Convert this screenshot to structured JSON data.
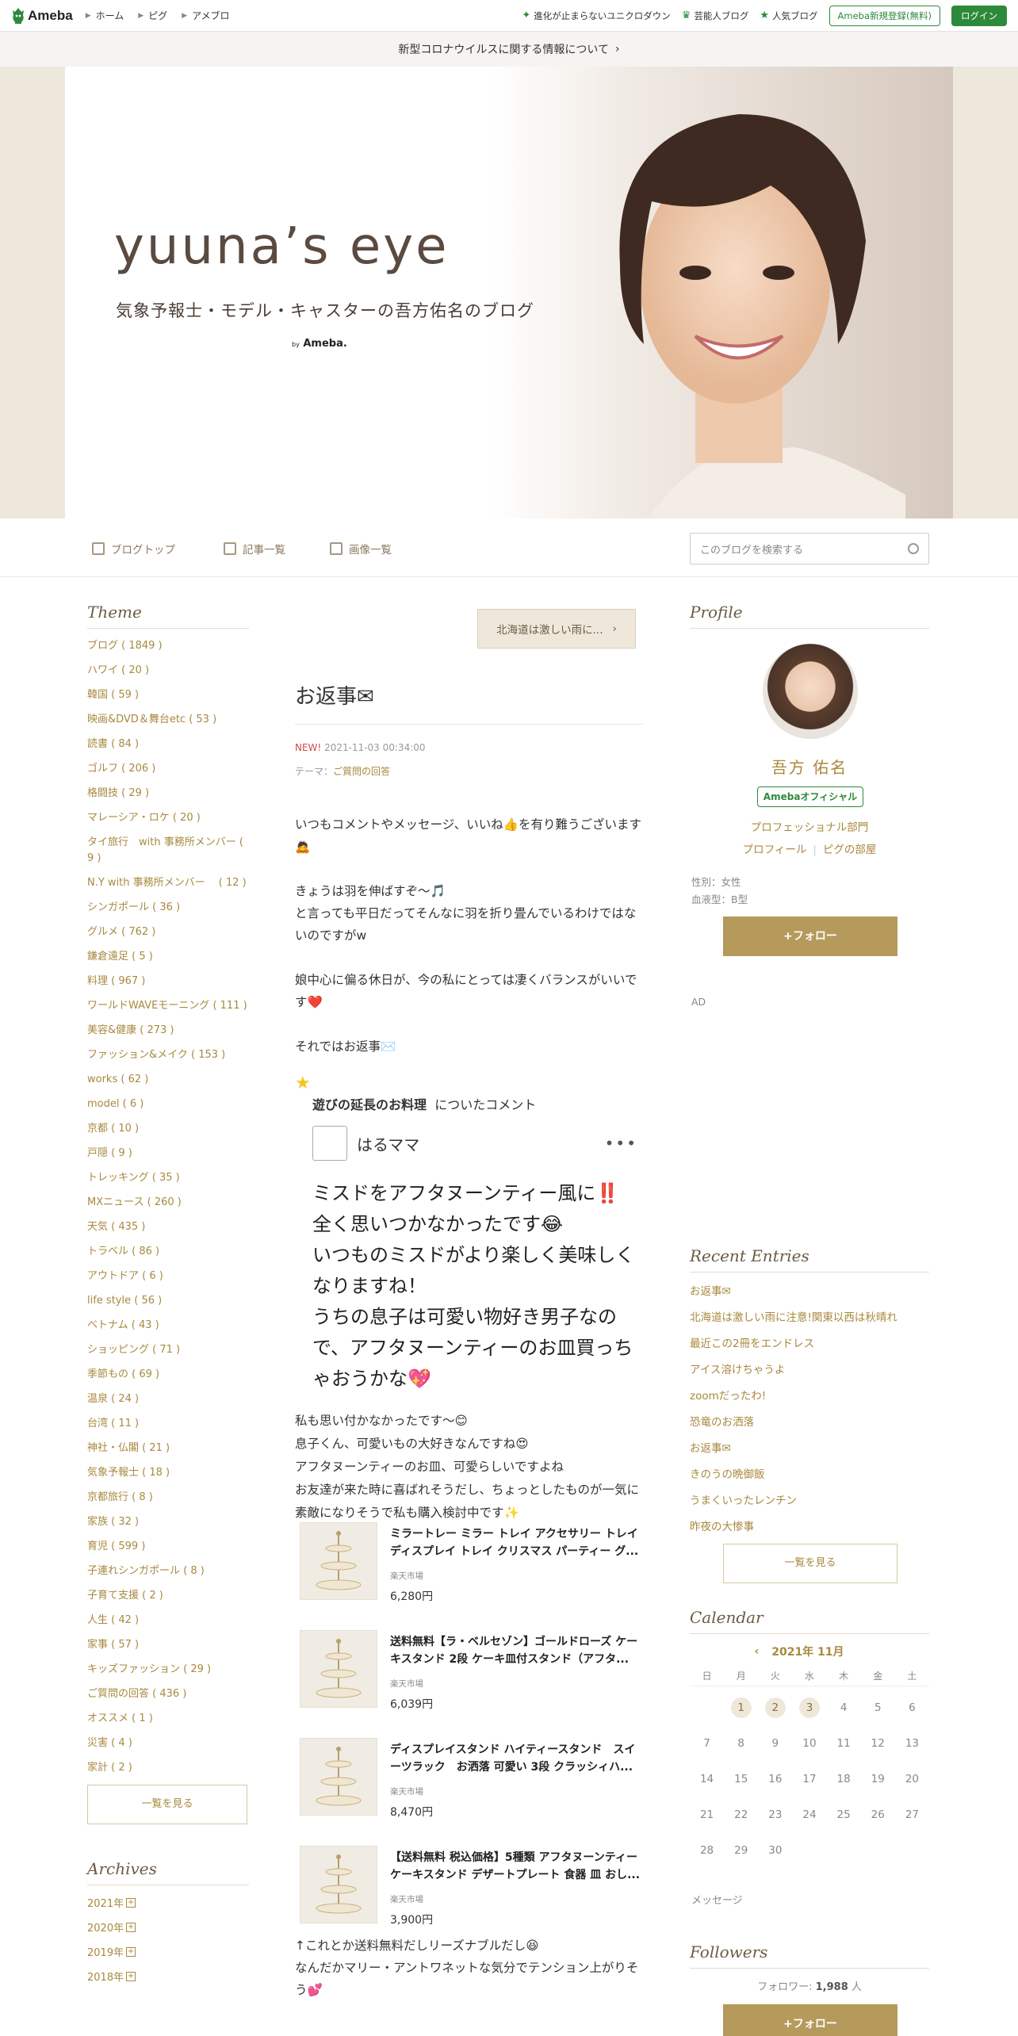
{
  "topbar": {
    "logo": "Ameba",
    "crumbs": [
      "ホーム",
      "ピグ",
      "アメブロ"
    ],
    "links": [
      {
        "label": "進化が止まらないユニクロダウン",
        "icon": "sparkle-icon"
      },
      {
        "label": "芸能人ブログ",
        "icon": "crown-icon"
      },
      {
        "label": "人気ブログ",
        "icon": "star-icon"
      }
    ],
    "register": "Ameba新規登録(無料)",
    "login": "ログイン",
    "accent": "#2d8a3a"
  },
  "notice": "新型コロナウイルスに関する情報について",
  "header": {
    "title": "yuuna’s eye",
    "subtitle": "気象予報士・モデル・キャスターの吾方佑名のブログ",
    "by": "by",
    "by_brand": "Ameba."
  },
  "nav": {
    "items": [
      "ブログトップ",
      "記事一覧",
      "画像一覧"
    ],
    "search_placeholder": "このブログを検索する"
  },
  "left": {
    "theme_title": "Theme",
    "themes": [
      "ブログ ( 1849 )",
      "ハワイ ( 20 )",
      "韓国 ( 59 )",
      "映画&DVD＆舞台etc ( 53 )",
      "読書 ( 84 )",
      "ゴルフ ( 206 )",
      "格闘技 ( 29 )",
      "マレーシア・ロケ ( 20 )",
      "タイ旅行　with 事務所メンバー ( 9 )",
      "N.Y with 事務所メンバー　 ( 12 )",
      "シンガポール ( 36 )",
      "グルメ ( 762 )",
      "鎌倉遠足 ( 5 )",
      "料理 ( 967 )",
      "ワールドWAVEモーニング ( 111 )",
      "美容&健康 ( 273 )",
      "ファッション&メイク ( 153 )",
      "works ( 62 )",
      "model ( 6 )",
      "京都 ( 10 )",
      "戸隠 ( 9 )",
      "トレッキング ( 35 )",
      "MXニュース ( 260 )",
      "天気 ( 435 )",
      "トラベル ( 86 )",
      "アウトドア ( 6 )",
      "life style ( 56 )",
      "ベトナム ( 43 )",
      "ショッピング ( 71 )",
      "季節もの ( 69 )",
      "温泉 ( 24 )",
      "台湾 ( 11 )",
      "神社・仏閣 ( 21 )",
      "気象予報士 ( 18 )",
      "京都旅行 ( 8 )",
      "家族 ( 32 )",
      "育児 ( 599 )",
      "子連れシンガポール ( 8 )",
      "子育て支援 ( 2 )",
      "人生 ( 42 )",
      "家事 ( 57 )",
      "キッズファッション ( 29 )",
      "ご質問の回答 ( 436 )",
      "オススメ ( 1 )",
      "災害 ( 4 )",
      "家計 ( 2 )"
    ],
    "more": "一覧を見る",
    "archive_title": "Archives",
    "archives": [
      "2021年",
      "2020年",
      "2019年",
      "2018年"
    ]
  },
  "post": {
    "prev_entry": "北海道は激しい雨に...",
    "title": "お返事✉",
    "new_label": "NEW!",
    "date": "2021-11-03 00:34:00",
    "theme_label": "テーマ：",
    "theme": "ご質問の回答",
    "paragraphs": [
      "いつもコメントやメッセージ、いいね👍を有り難うございます🙇",
      "きょうは羽を伸ばすぞ〜🎵\nと言っても平日だってそんなに羽を折り畳んでいるわけではないのですがw",
      "娘中心に偏る休日が、今の私にとっては凄くバランスがいいです❤️",
      "それではお返事✉️"
    ],
    "comment_source": "遊びの延長のお料理",
    "comment_source_suffix": "についたコメント",
    "commenter": "はるママ",
    "comment": "ミスドをアフタヌーンティー風に‼️\n全く思いつかなかったです😂\nいつものミスドがより楽しく美味しくなりますね！\nうちの息子は可愛い物好き男子なので、アフタヌーンティーのお皿買っちゃおうかな💖",
    "reply": "私も思い付かなかったです〜😊\n息子くん、可愛いもの大好きなんですね😍\nアフタヌーンティーのお皿、可愛らしいですよね\nお友達が来た時に喜ばれそうだし、ちょっとしたものが一気に素敵になりそうで私も購入検討中です✨",
    "products": [
      {
        "name": "ミラートレー ミラー トレイ アクセサリー トレイ ディスプレイ トレイ クリスマス パーティー グ...",
        "shop": "楽天市場",
        "price": "6,280円"
      },
      {
        "name": "送料無料【ラ・ベルセゾン】ゴールドローズ ケーキスタンド 2段 ケーキ皿付スタンド（アフタ...",
        "shop": "楽天市場",
        "price": "6,039円"
      },
      {
        "name": "ディスプレイスタンド ハイティースタンド　スイーツラック　お洒落 可愛い 3段 クラッシィハ...",
        "shop": "楽天市場",
        "price": "8,470円"
      },
      {
        "name": "【送料無料 税込価格】5種類 アフタヌーンティー ケーキスタンド デザートプレート 食器 皿 おし...",
        "shop": "楽天市場",
        "price": "3,900円"
      }
    ],
    "closing": "↑これとか送料無料だしリーズナブルだし😆\nなんだかマリー・アントワネットな気分でテンション上がりそう💕"
  },
  "right": {
    "profile_title": "Profile",
    "name": "吾方 佑名",
    "badge": "Amebaオフィシャル",
    "category": "プロフェッショナル部門",
    "link_profile": "プロフィール",
    "link_pigg": "ピグの部屋",
    "gender": "性別：女性",
    "blood": "血液型：B型",
    "follow": "+フォロー",
    "ad": "AD",
    "recent_title": "Recent Entries",
    "recent": [
      "お返事✉",
      "北海道は激しい雨に注意!関東以西は秋晴れ",
      "最近この2冊をエンドレス",
      "アイス溶けちゃうよ",
      "zoomだったわ!",
      "恐竜のお洒落",
      "お返事✉",
      "きのうの晩御飯",
      "うまくいったレンチン",
      "昨夜の大惨事"
    ],
    "more": "一覧を見る",
    "calendar_title": "Calendar",
    "month": "2021年 11月",
    "dow": [
      "日",
      "月",
      "火",
      "水",
      "木",
      "金",
      "土"
    ],
    "days": [
      [
        "",
        "1",
        "2",
        "3",
        "4",
        "5",
        "6"
      ],
      [
        "7",
        "8",
        "9",
        "10",
        "11",
        "12",
        "13"
      ],
      [
        "14",
        "15",
        "16",
        "17",
        "18",
        "19",
        "20"
      ],
      [
        "21",
        "22",
        "23",
        "24",
        "25",
        "26",
        "27"
      ],
      [
        "28",
        "29",
        "30",
        "",
        "",
        "",
        ""
      ]
    ],
    "entry_days": [
      "1",
      "2",
      "3"
    ],
    "message": "メッセージ",
    "followers_title": "Followers",
    "followers_label": "フォロワー:",
    "followers_count": "1,988",
    "followers_unit": "人",
    "follow2": "+フォロー"
  }
}
